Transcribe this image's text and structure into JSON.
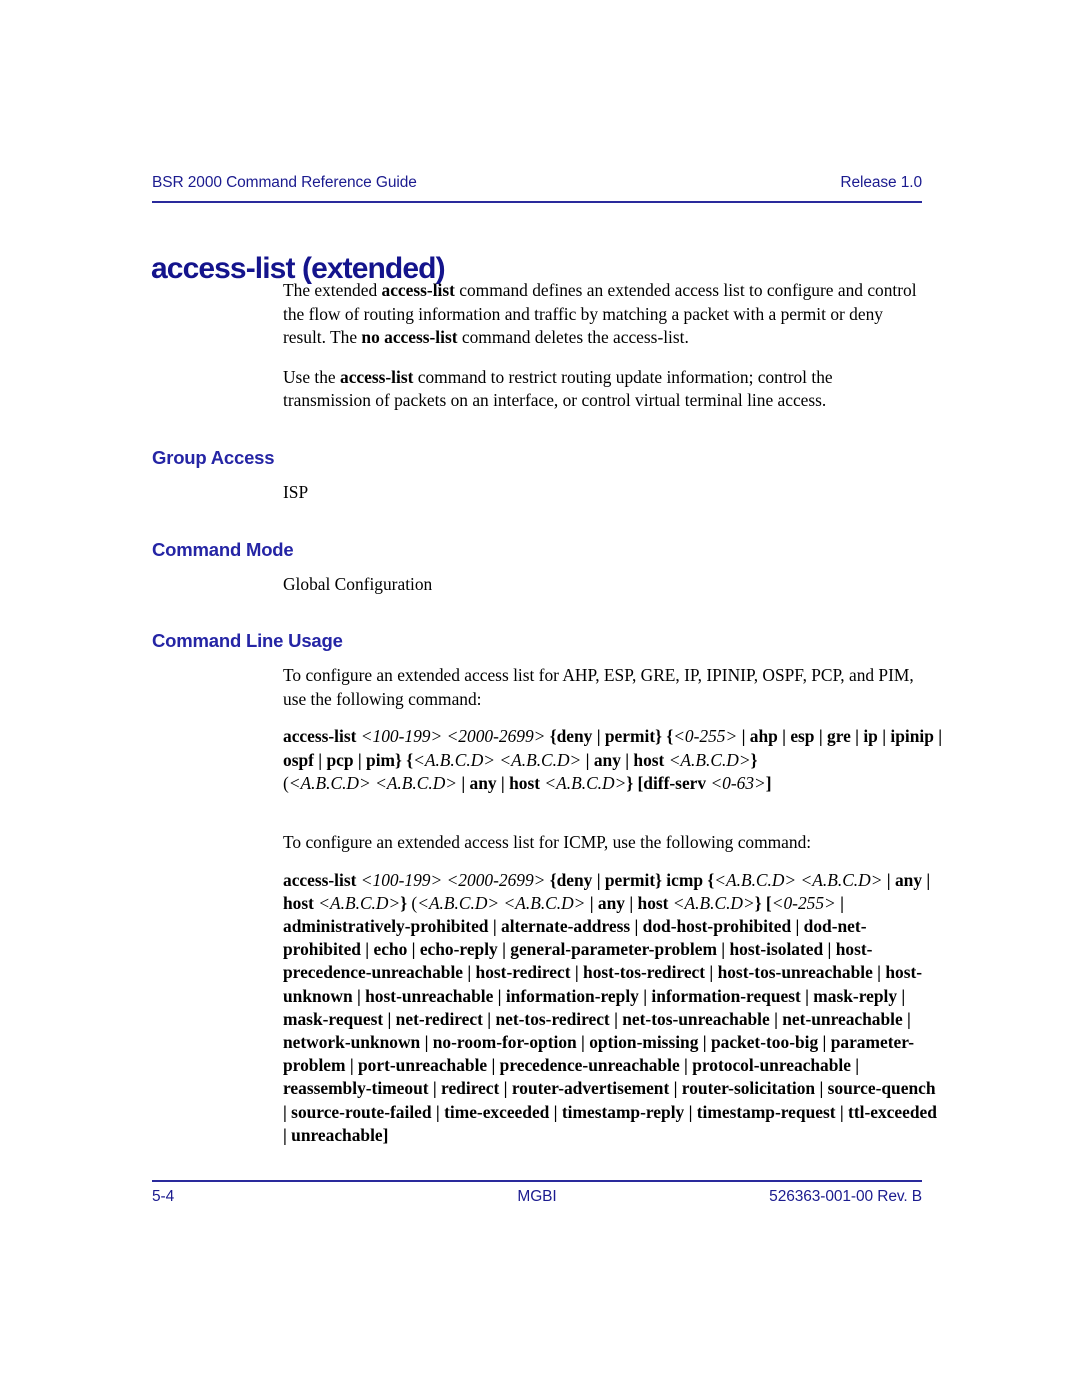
{
  "header": {
    "guide_title": "BSR 2000 Command Reference Guide",
    "release": "Release 1.0"
  },
  "page_title": "access-list (extended)",
  "intro": {
    "paragraph_1_part_1": "The extended ",
    "paragraph_1_bold_1": "access-list",
    "paragraph_1_part_2": " command defines an extended access list to configure and control the flow of routing information and traffic by matching a packet with a permit or deny result. The ",
    "paragraph_1_bold_2": "no access-list",
    "paragraph_1_part_3": " command deletes the access-list.",
    "paragraph_2_part_1": "Use the ",
    "paragraph_2_bold_1": "access-list",
    "paragraph_2_part_2": " command to restrict routing update information; control the transmission of packets on an interface, or control virtual terminal line access."
  },
  "sections": {
    "group_access": {
      "heading": "Group Access",
      "body": "ISP"
    },
    "command_mode": {
      "heading": "Command Mode",
      "body": "Global Configuration"
    },
    "command_line_usage": {
      "heading": "Command Line Usage",
      "intro_1": "To configure an extended access list for AHP, ESP, GRE, IP, IPINIP, OSPF, PCP, and PIM, use the following command:",
      "intro_2": "To configure an extended access list for ICMP, use the following command:"
    }
  },
  "syntax_ip": {
    "cmd": "access-list",
    "range_1": "<100-199>",
    "range_2": "<2000-2699>",
    "deny_permit": "{deny | permit}",
    "proto_open": "{",
    "proto_num": "<0-255>",
    "proto_list": " | ahp | esp | gre | ip | ipinip | ospf | pcp | pim}",
    "src_open": " {",
    "src_addr_1": "<A.B.C.D>",
    "src_addr_2": "<A.B.C.D>",
    "src_any_host": " | any | host ",
    "src_host_addr": "<A.B.C.D>",
    "src_close": "}",
    "dst_open": "(",
    "dst_addr_1": "<A.B.C.D>",
    "dst_addr_2": "<A.B.C.D>",
    "dst_any_host": " | any | host ",
    "dst_host_addr": "<A.B.C.D>",
    "dst_close": "} ",
    "diffserv": "[diff-serv ",
    "diffserv_range": "<0-63>",
    "diffserv_close": "]"
  },
  "syntax_icmp": {
    "cmd": "access-list",
    "range_1": "<100-199>",
    "range_2": "<2000-2699>",
    "deny_permit": "{deny | permit} icmp ",
    "src_open": "{",
    "src_addr_1": "<A.B.C.D>",
    "src_addr_2": "<A.B.C.D>",
    "src_any_host": " | any | host ",
    "src_host_addr": "<A.B.C.D>",
    "src_close": "} ",
    "dst_open": "(",
    "dst_addr_1": "<A.B.C.D>",
    "dst_addr_2": "<A.B.C.D>",
    "dst_any_host": " | any | host ",
    "dst_host_addr": "<A.B.C.D>",
    "dst_close": "} ",
    "type_open": "[",
    "type_num": "<0-255>",
    "type_keywords": " | administratively-prohibited | alternate-address | dod-host-prohibited | dod-net-prohibited | echo | echo-reply | general-parameter-problem | host-isolated | host-precedence-unreachable | host-redirect | host-tos-redirect | host-tos-unreachable | host-unknown | host-unreachable | information-reply | information-request | mask-reply | mask-request | net-redirect | net-tos-redirect | net-tos-unreachable | net-unreachable | network-unknown | no-room-for-option | option-missing | packet-too-big | parameter-problem | port-unreachable | precedence-unreachable | protocol-unreachable | reassembly-timeout | redirect | router-advertisement | router-solicitation | source-quench | source-route-failed | time-exceeded | timestamp-reply | timestamp-request | ttl-exceeded | unreachable]"
  },
  "footer": {
    "page_number": "5-4",
    "company": "MGBI",
    "doc_number": "526363-001-00 Rev. B"
  },
  "colors": {
    "heading_blue": "#2525a5",
    "title_blue": "#14148c",
    "rule_blue": "#2a2a9c",
    "running_blue": "#1b1b8f",
    "body_black": "#000000",
    "page_background": "#ffffff"
  }
}
